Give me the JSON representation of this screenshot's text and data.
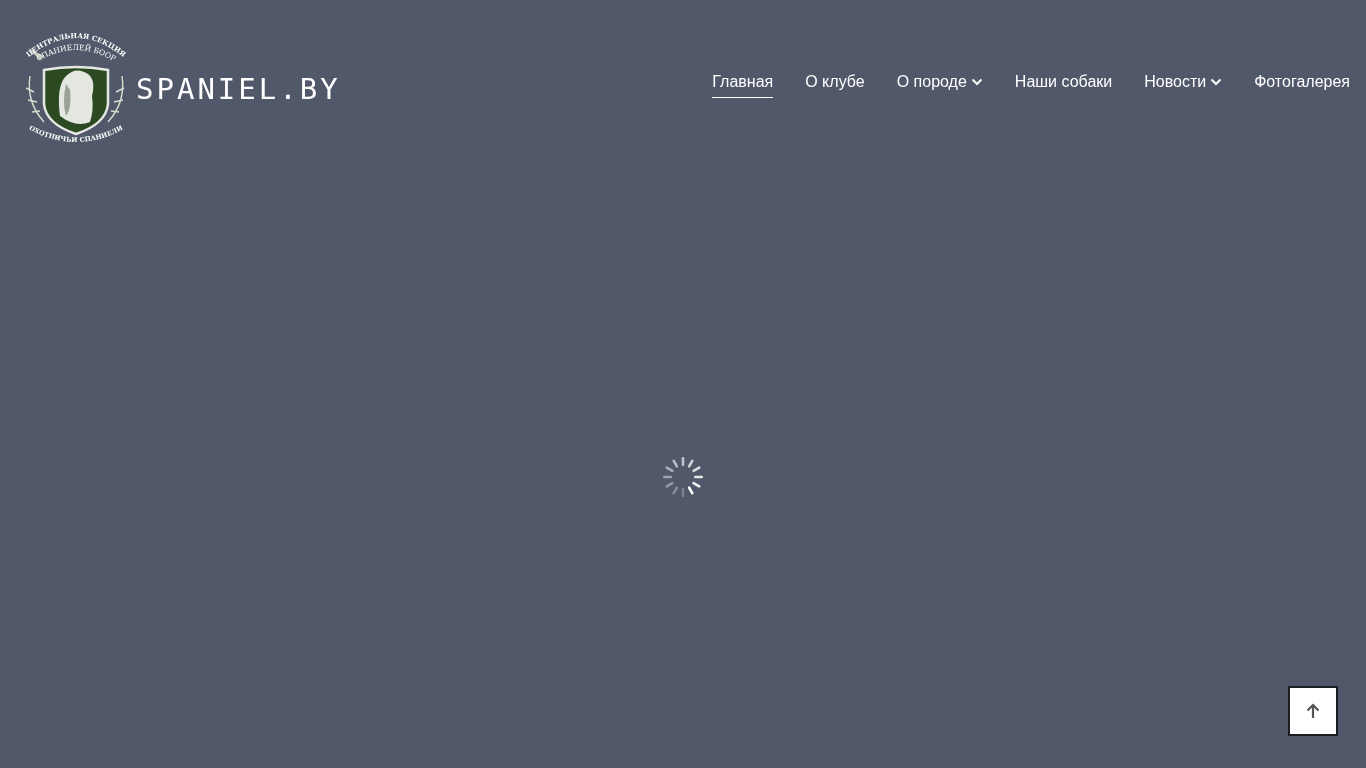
{
  "header": {
    "logo": {
      "emblem_top": "ЦЕНТРАЛЬНАЯ СЕКЦИЯ",
      "emblem_sub": "СПАНИЕЛЕЙ БООР",
      "emblem_bottom": "ОХОТНИЧЬИ СПАНИЕЛИ",
      "wordmark": "SPANIEL.BY"
    },
    "nav": [
      {
        "label": "Главная",
        "selected": true,
        "has_dropdown": false
      },
      {
        "label": "О клубе",
        "selected": false,
        "has_dropdown": false
      },
      {
        "label": "О породе",
        "selected": false,
        "has_dropdown": true
      },
      {
        "label": "Наши собаки",
        "selected": false,
        "has_dropdown": false
      },
      {
        "label": "Новости",
        "selected": false,
        "has_dropdown": true
      },
      {
        "label": "Фотогалерея",
        "selected": false,
        "has_dropdown": false
      }
    ]
  },
  "loading": true,
  "back_to_top": {
    "visible": true
  }
}
